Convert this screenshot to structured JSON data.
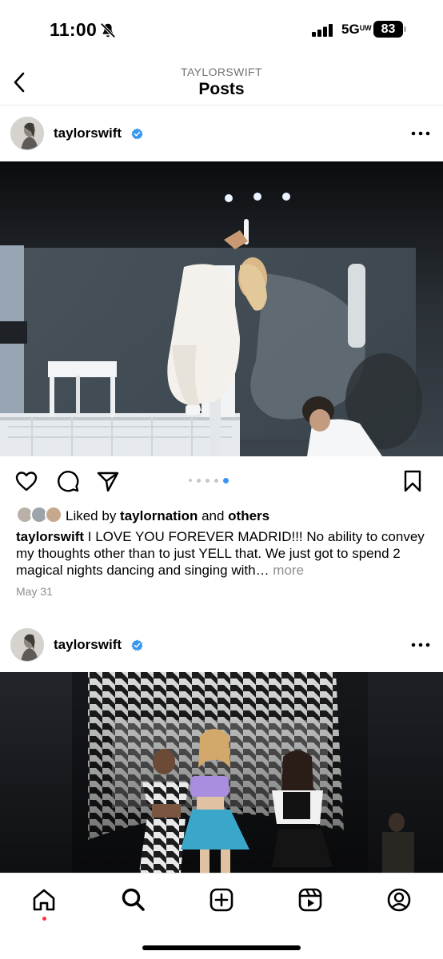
{
  "status_bar": {
    "time": "11:00",
    "network": "5G",
    "network_suffix": "UW",
    "battery": "83"
  },
  "header": {
    "account": "TAYLORSWIFT",
    "title": "Posts"
  },
  "posts": [
    {
      "username": "taylorswift",
      "verified": true,
      "carousel": {
        "total": 5,
        "active_index": 4
      },
      "likes": {
        "prefix": "Liked by ",
        "liker": "taylornation",
        "joiner": " and ",
        "suffix": "others"
      },
      "caption": {
        "username": "taylorswift",
        "text": " I LOVE YOU FOREVER MADRID!!! No ability to convey my thoughts other than to just YELL that. We just got to spend 2 magical nights dancing and singing with…",
        "more": " more"
      },
      "date": "May 31"
    },
    {
      "username": "taylorswift",
      "verified": true
    }
  ],
  "icons": {
    "back": "chevron-left-icon",
    "like": "heart-icon",
    "comment": "comment-icon",
    "share": "send-icon",
    "save": "bookmark-icon",
    "more": "more-horizontal-icon",
    "verified": "verified-badge-icon"
  },
  "nav": [
    "home",
    "search",
    "create",
    "reels",
    "profile"
  ],
  "colors": {
    "verified": "#3797f0",
    "active_dot": "#3797f0",
    "secondary_text": "#8e8e8e",
    "notification_dot": "#ff3040"
  }
}
